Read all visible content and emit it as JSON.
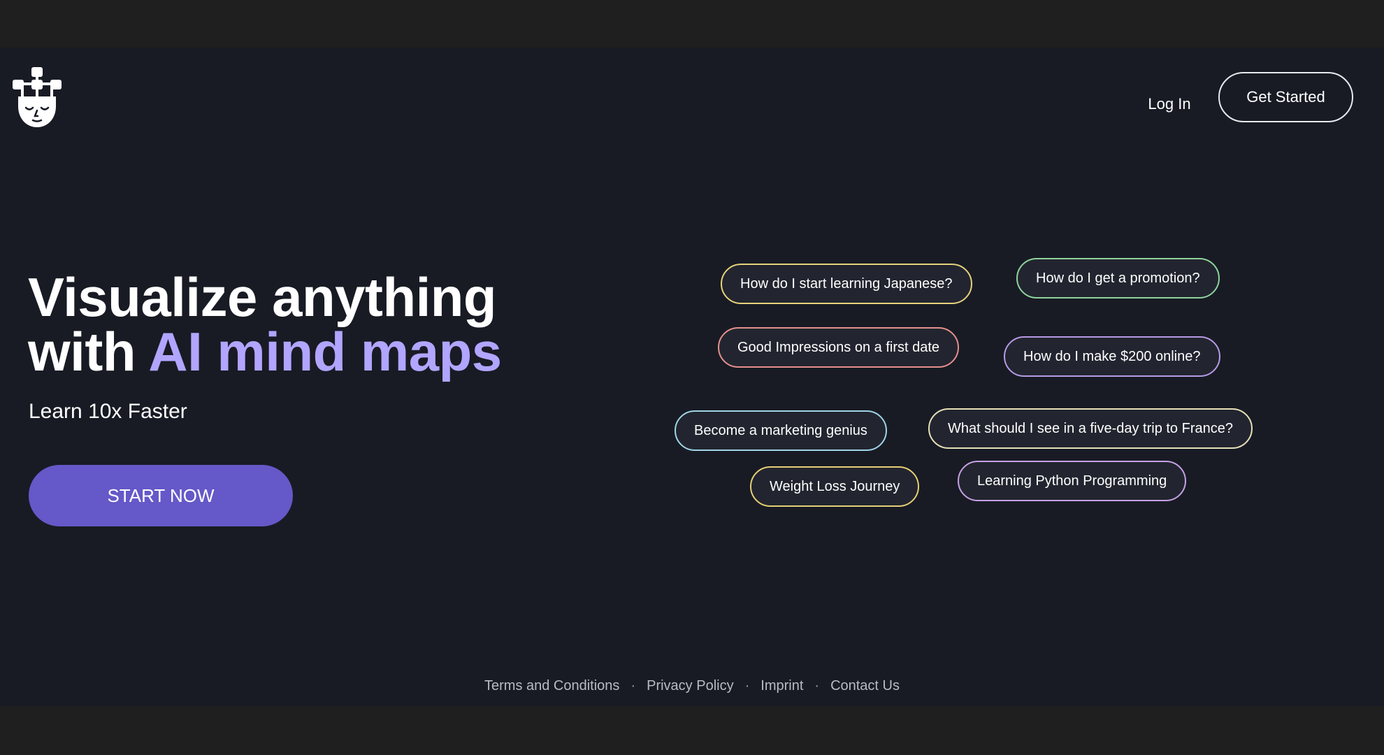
{
  "header": {
    "login_label": "Log In",
    "cta_label": "Get Started"
  },
  "hero": {
    "title_line1": "Visualize anything",
    "title_line2_prefix": "with ",
    "title_line2_accent": "AI mind maps",
    "subtitle": "Learn 10x Faster",
    "start_label": "START NOW"
  },
  "colors": {
    "accent_text": "#b1a5ff",
    "start_button": "#6558c8",
    "background": "#181b24"
  },
  "topics": [
    {
      "label": "How do I start learning Japanese?",
      "border": "#e6d27a"
    },
    {
      "label": "How do I get a promotion?",
      "border": "#8fd39c"
    },
    {
      "label": "Good Impressions on a first date",
      "border": "#e6908c"
    },
    {
      "label": "How do I make $200 online?",
      "border": "#b79ae6"
    },
    {
      "label": "Become a marketing genius",
      "border": "#9fd4e6"
    },
    {
      "label": "What should I see in a five-day trip to France?",
      "border": "#e6e0b8"
    },
    {
      "label": "Weight Loss Journey",
      "border": "#e6cf74"
    },
    {
      "label": "Learning Python Programming",
      "border": "#c7a0e6"
    }
  ],
  "footer": {
    "links": [
      "Terms and Conditions",
      "Privacy Policy",
      "Imprint",
      "Contact Us"
    ],
    "separator": "·"
  }
}
